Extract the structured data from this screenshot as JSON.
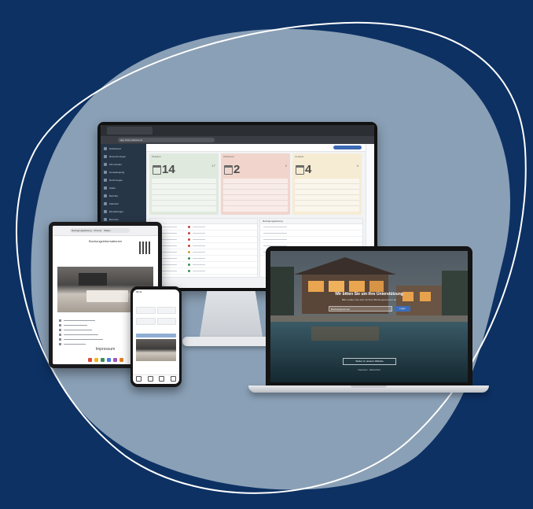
{
  "colors": {
    "background": "#0d3163",
    "blob": "#8aa0b6",
    "card_green": "#dfe9dd",
    "card_red": "#f1d5cc",
    "card_yellow": "#f6ecd4",
    "accent_blue": "#3d6bb3"
  },
  "monitor": {
    "tab_label": "Belegung Übersicht",
    "url": "app.hotel-software.at",
    "sidebar_items": [
      "Dashboard",
      "Reservierungen",
      "Zimmerplan",
      "Housekeeping",
      "Rechnungen",
      "Gäste",
      "Berichte",
      "Kalender",
      "Einstellungen",
      "Benutzer",
      "Hilfe"
    ],
    "cards": [
      {
        "header": "Check-in",
        "value": "14",
        "mini": "17",
        "color": "#dfe9dd"
      },
      {
        "header": "Check-out",
        "value": "2",
        "mini": "2",
        "color": "#f1d5cc"
      },
      {
        "header": "Im Haus",
        "value": "4",
        "mini": "4",
        "color": "#f6ecd4"
      }
    ],
    "status_dots": [
      "#c0463c",
      "#c0463c",
      "#c0463c",
      "#c0463c",
      "#d0a133",
      "#3c8f57",
      "#3c8f57",
      "#3c8f57"
    ],
    "right_panel_title": "Reinigungsplanung"
  },
  "tablet": {
    "address": "Reinigungsplanung · Zimmer · Status",
    "title": "Buchungsinformationen",
    "footer": "Impressum"
  },
  "phone": {
    "status_time": "09:41"
  },
  "laptop": {
    "hero_title": "Wir bitten Sie um Ihre Unterstützung",
    "hero_subtitle": "Bitte melden Sie sich mit Ihrer Buchungsnummer an",
    "field_label": "Buchungsnummer",
    "login_button": "Login",
    "web_button": "Weiter zu unserer Website",
    "imprint": "Impressum · Datenschutz"
  }
}
